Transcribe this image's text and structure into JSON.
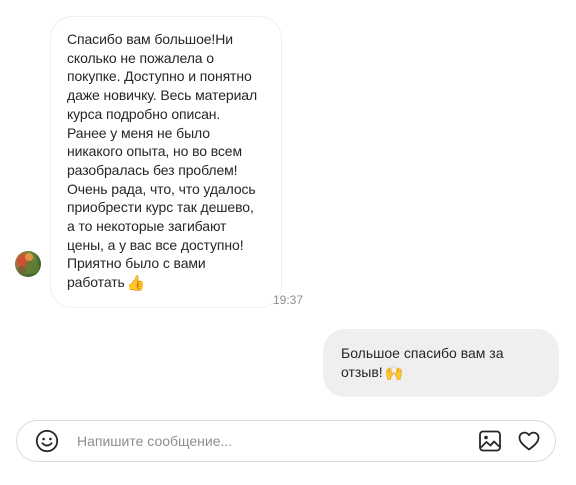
{
  "conversation": {
    "incoming_message": {
      "text": "Спасибо вам большое!Ни сколько не пожалела о покупке. Доступно и понятно даже новичку. Весь материал курса подробно описан. Ранее у меня не было никакого опыта, но во всем разобралась без проблем! Очень рада, что, что удалось приобрести курс так дешево, а то некоторые загибают цены, а у вас все доступно! Приятно было с вами работать",
      "emoji": "👍"
    },
    "timestamp": "19:37",
    "outgoing_message": {
      "text": "Большое спасибо вам за отзыв!",
      "emoji": "🙌"
    }
  },
  "composer": {
    "placeholder": "Напишите сообщение...",
    "value": ""
  },
  "icons": {
    "emoji_picker": "smiley-icon",
    "attach_image": "image-icon",
    "like": "heart-icon"
  },
  "colors": {
    "outgoing_bubble_bg": "#efefef",
    "incoming_bubble_border": "#efefef",
    "timestamp": "#8e8e8e",
    "text": "#262626",
    "composer_border": "#dbdbdb"
  }
}
